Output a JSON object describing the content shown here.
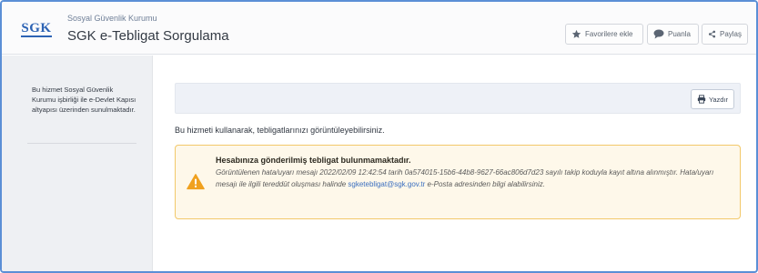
{
  "header": {
    "logo": "SGK",
    "org_name": "Sosyal Güvenlik Kurumu",
    "title": "SGK e-Tebligat Sorgulama",
    "buttons": {
      "favorites": "Favorilere ekle",
      "rate": "Puanla",
      "share": "Paylaş"
    }
  },
  "sidebar": {
    "note": "Bu hizmet Sosyal Güvenlik Kurumu işbirliği ile e-Devlet Kapısı altyapısı üzerinden sunulmaktadır."
  },
  "main": {
    "print_label": "Yazdır",
    "intro": "Bu hizmeti kullanarak, tebligatlarınızı görüntüleyebilirsiniz.",
    "alert": {
      "title": "Hesabınıza gönderilmiş tebligat bulunmamaktadır.",
      "body_before": "Görüntülenen hata/uyarı mesajı 2022/02/09 12:42:54 tarih 0a574015-15b6-44b8-9627-66ac806d7d23 sayılı takip koduyla kayıt altına alınmıştır. Hata/uyarı mesajı ile ilgili tereddüt oluşması halinde ",
      "email": "sgketebligat@sgk.gov.tr",
      "body_after": " e-Posta adresinden bilgi alabilirsiniz."
    }
  },
  "colors": {
    "brand": "#2d63b4",
    "frame": "#5b8fd6",
    "alert_bg": "#fef8ea",
    "alert_border": "#f2c86a",
    "warning_icon": "#f0a11f",
    "link": "#3b6fbf"
  },
  "icons": {
    "favorites": "star-icon",
    "rate": "speech-bubble-icon",
    "share": "share-icon",
    "print": "printer-icon",
    "alert": "warning-triangle-icon"
  }
}
